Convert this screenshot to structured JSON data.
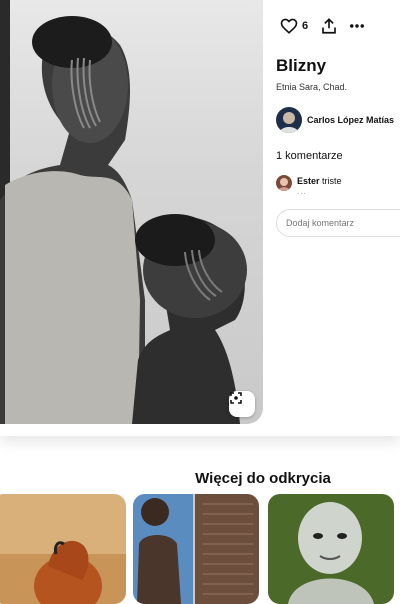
{
  "pin": {
    "like_count": "6",
    "title": "Blizny",
    "description": "Etnia Sara, Chad.",
    "author": "Carlos López Matías",
    "comments_label": "1 komentarze",
    "comment": {
      "user": "Ester",
      "text": "triste",
      "dots": "..."
    },
    "comment_placeholder": "Dodaj komentarz",
    "icons": [
      "heart-icon",
      "share-icon",
      "more-icon",
      "visual-search-icon"
    ]
  },
  "more": {
    "title": "Więcej do odkrycia",
    "tiles": [
      "tile-desert-sculpture",
      "tile-scarification-backs",
      "tile-face-paint"
    ]
  }
}
